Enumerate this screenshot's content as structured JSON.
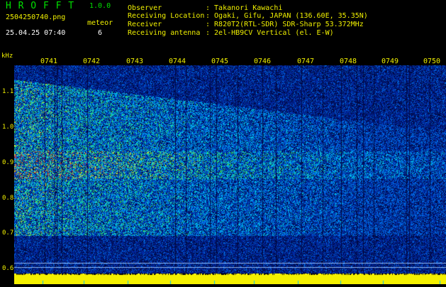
{
  "app": {
    "name": "H R O F F T",
    "version": "1.0.0"
  },
  "file": {
    "name": "2504250740.png",
    "datetime": "25.04.25 07:40"
  },
  "detections": {
    "label": "meteor",
    "count": "6"
  },
  "info": {
    "observer_label": "Observer",
    "observer_value": ": Takanori Kawachi",
    "location_label": "Receiving Location",
    "location_value": ": Ogaki, Gifu, JAPAN (136.60E, 35.35N)",
    "receiver_label": "Receiver",
    "receiver_value": ": R820T2(RTL-SDR) SDR-Sharp 53.372MHz",
    "antenna_label": "Receiving antenna",
    "antenna_value": ": 2el-HB9CV Vertical (el. E-W)"
  },
  "axes": {
    "freq_unit": "kHz",
    "freq_ticks": [
      "1.1",
      "1.0",
      "0.9",
      "0.8",
      "0.7",
      "0.6"
    ],
    "time_ticks": [
      "0741",
      "0742",
      "0743",
      "0744",
      "0745",
      "0746",
      "0747",
      "0748",
      "0749",
      "0750"
    ]
  },
  "colors": {
    "background": "#000000",
    "label": "#f0f000",
    "plot_bg": "#00104a",
    "power_strip": "#f4f000"
  }
}
